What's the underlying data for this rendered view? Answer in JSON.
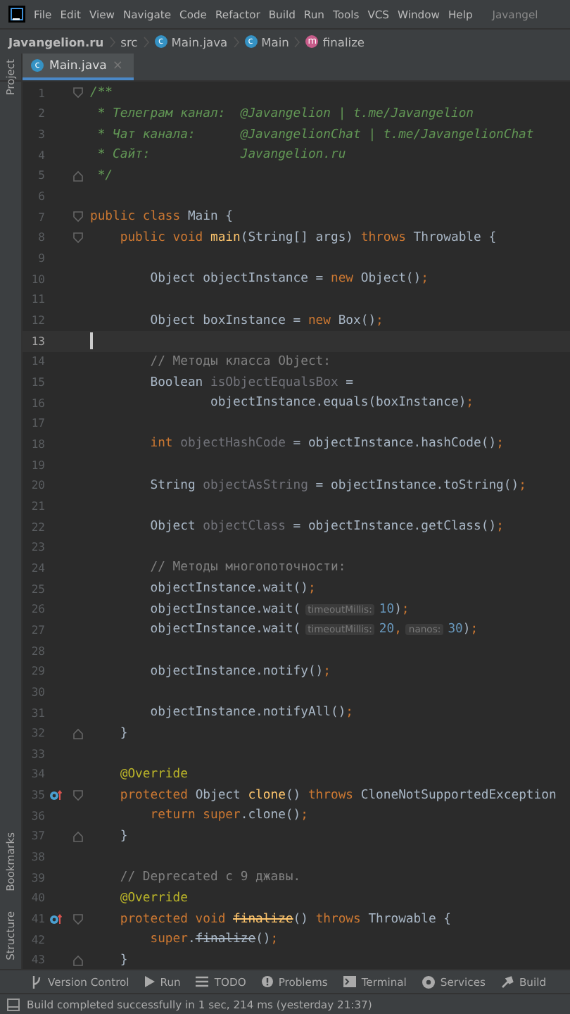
{
  "menu_bar": {
    "items": [
      "File",
      "Edit",
      "View",
      "Navigate",
      "Code",
      "Refactor",
      "Build",
      "Run",
      "Tools",
      "VCS",
      "Window",
      "Help"
    ],
    "project_title": "Javangel"
  },
  "breadcrumbs": [
    {
      "label": "Javangelion.ru",
      "kind": "project"
    },
    {
      "label": "src",
      "kind": "folder"
    },
    {
      "label": "Main.java",
      "kind": "class",
      "badge": "c"
    },
    {
      "label": "Main",
      "kind": "class",
      "badge": "c"
    },
    {
      "label": "finalize",
      "kind": "method",
      "badge": "m"
    }
  ],
  "tabs": [
    {
      "label": "Main.java",
      "badge": "c",
      "selected": true,
      "close": "×"
    }
  ],
  "side_tools": [
    {
      "label": "Project",
      "kind": "top"
    },
    {
      "label": "Bookmarks",
      "kind": "bottom"
    },
    {
      "label": "Structure",
      "kind": "bottom"
    }
  ],
  "lines": [
    {
      "n": "1",
      "current": false,
      "fold": {
        "kind": "start"
      },
      "t": [
        {
          "kind": "doc",
          "text": "/**"
        }
      ]
    },
    {
      "n": "2",
      "current": false,
      "t": [
        {
          "kind": "doc",
          "text": " * Телеграм канал:  @Javangelion | t.me/Javangelion"
        }
      ]
    },
    {
      "n": "3",
      "current": false,
      "t": [
        {
          "kind": "doc",
          "text": " * Чат канала:      @JavangelionChat | t.me/JavangelionChat"
        }
      ]
    },
    {
      "n": "4",
      "current": false,
      "t": [
        {
          "kind": "doc",
          "text": " * Сайт:            Javangelion.ru"
        }
      ]
    },
    {
      "n": "5",
      "current": false,
      "fold": {
        "kind": "end"
      },
      "t": [
        {
          "kind": "doc",
          "text": " */"
        }
      ]
    },
    {
      "n": "6",
      "current": false
    },
    {
      "n": "7",
      "current": false,
      "fold": {
        "kind": "start"
      },
      "t": [
        {
          "kind": "kw",
          "text": "public class "
        },
        {
          "kind": "plain",
          "text": "Main {"
        }
      ]
    },
    {
      "n": "8",
      "current": false,
      "fold": {
        "kind": "start"
      },
      "t": [
        {
          "kind": "kw",
          "text": "    public void "
        },
        {
          "kind": "decl",
          "text": "main"
        },
        {
          "kind": "plain",
          "text": "(String[] args) "
        },
        {
          "kind": "kw",
          "text": "throws "
        },
        {
          "kind": "plain",
          "text": "Throwable {"
        }
      ]
    },
    {
      "n": "9",
      "current": false
    },
    {
      "n": "10",
      "current": false,
      "t": [
        {
          "kind": "plain",
          "text": "        Object objectInstance = "
        },
        {
          "kind": "kw",
          "text": "new "
        },
        {
          "kind": "plain",
          "text": "Object()"
        },
        {
          "kind": "kw",
          "text": ";"
        }
      ]
    },
    {
      "n": "11",
      "current": false
    },
    {
      "n": "12",
      "current": false,
      "t": [
        {
          "kind": "plain",
          "text": "        Object boxInstance = "
        },
        {
          "kind": "kw",
          "text": "new "
        },
        {
          "kind": "plain",
          "text": "Box()"
        },
        {
          "kind": "kw",
          "text": ";"
        }
      ]
    },
    {
      "n": "13",
      "current": true
    },
    {
      "n": "14",
      "current": false,
      "t": [
        {
          "kind": "comment",
          "text": "        // Методы класса Object:"
        }
      ]
    },
    {
      "n": "15",
      "current": false,
      "t": [
        {
          "kind": "plain",
          "text": "        Boolean "
        },
        {
          "kind": "unused",
          "text": "isObjectEqualsBox"
        },
        {
          "kind": "plain",
          "text": " ="
        }
      ]
    },
    {
      "n": "16",
      "current": false,
      "t": [
        {
          "kind": "plain",
          "text": "                objectInstance.equals(boxInstance)"
        },
        {
          "kind": "kw",
          "text": ";"
        }
      ]
    },
    {
      "n": "17",
      "current": false
    },
    {
      "n": "18",
      "current": false,
      "t": [
        {
          "kind": "kw",
          "text": "        int "
        },
        {
          "kind": "unused",
          "text": "objectHashCode"
        },
        {
          "kind": "plain",
          "text": " = objectInstance.hashCode()"
        },
        {
          "kind": "kw",
          "text": ";"
        }
      ]
    },
    {
      "n": "19",
      "current": false
    },
    {
      "n": "20",
      "current": false,
      "t": [
        {
          "kind": "plain",
          "text": "        String "
        },
        {
          "kind": "unused",
          "text": "objectAsString"
        },
        {
          "kind": "plain",
          "text": " = objectInstance.toString()"
        },
        {
          "kind": "kw",
          "text": ";"
        }
      ]
    },
    {
      "n": "21",
      "current": false
    },
    {
      "n": "22",
      "current": false,
      "t": [
        {
          "kind": "plain",
          "text": "        Object "
        },
        {
          "kind": "unused",
          "text": "objectClass"
        },
        {
          "kind": "plain",
          "text": " = objectInstance.getClass()"
        },
        {
          "kind": "kw",
          "text": ";"
        }
      ]
    },
    {
      "n": "23",
      "current": false
    },
    {
      "n": "24",
      "current": false,
      "t": [
        {
          "kind": "comment",
          "text": "        // Методы многопоточности:"
        }
      ]
    },
    {
      "n": "25",
      "current": false,
      "t": [
        {
          "kind": "plain",
          "text": "        objectInstance.wait()"
        },
        {
          "kind": "kw",
          "text": ";"
        }
      ]
    },
    {
      "n": "26",
      "current": false,
      "t": [
        {
          "kind": "plain",
          "text": "        objectInstance.wait("
        },
        {
          "kind": "hint",
          "text": "timeoutMillis:"
        },
        {
          "kind": "num",
          "text": "10"
        },
        {
          "kind": "plain",
          "text": ")"
        },
        {
          "kind": "kw",
          "text": ";"
        }
      ]
    },
    {
      "n": "27",
      "current": false,
      "t": [
        {
          "kind": "plain",
          "text": "        objectInstance.wait("
        },
        {
          "kind": "hint",
          "text": "timeoutMillis:"
        },
        {
          "kind": "num",
          "text": "20"
        },
        {
          "kind": "kw",
          "text": ","
        },
        {
          "kind": "hint",
          "text": "nanos:"
        },
        {
          "kind": "num",
          "text": "30"
        },
        {
          "kind": "plain",
          "text": ")"
        },
        {
          "kind": "kw",
          "text": ";"
        }
      ]
    },
    {
      "n": "28",
      "current": false
    },
    {
      "n": "29",
      "current": false,
      "t": [
        {
          "kind": "plain",
          "text": "        objectInstance.notify()"
        },
        {
          "kind": "kw",
          "text": ";"
        }
      ]
    },
    {
      "n": "30",
      "current": false
    },
    {
      "n": "31",
      "current": false,
      "t": [
        {
          "kind": "plain",
          "text": "        objectInstance.notifyAll()"
        },
        {
          "kind": "kw",
          "text": ";"
        }
      ]
    },
    {
      "n": "32",
      "current": false,
      "fold": {
        "kind": "end"
      },
      "t": [
        {
          "kind": "plain",
          "text": "    }"
        }
      ]
    },
    {
      "n": "33",
      "current": false
    },
    {
      "n": "34",
      "current": false,
      "t": [
        {
          "kind": "annotation",
          "text": "    @Override"
        }
      ]
    },
    {
      "n": "35",
      "current": false,
      "fold": {
        "kind": "start"
      },
      "marker": {
        "kind": "override"
      },
      "t": [
        {
          "kind": "kw",
          "text": "    protected "
        },
        {
          "kind": "plain",
          "text": "Object "
        },
        {
          "kind": "decl",
          "text": "clone"
        },
        {
          "kind": "plain",
          "text": "() "
        },
        {
          "kind": "kw",
          "text": "throws "
        },
        {
          "kind": "plain",
          "text": "CloneNotSupportedException"
        }
      ]
    },
    {
      "n": "36",
      "current": false,
      "t": [
        {
          "kind": "kw",
          "text": "        return super"
        },
        {
          "kind": "plain",
          "text": ".clone()"
        },
        {
          "kind": "kw",
          "text": ";"
        }
      ]
    },
    {
      "n": "37",
      "current": false,
      "fold": {
        "kind": "end"
      },
      "t": [
        {
          "kind": "plain",
          "text": "    }"
        }
      ]
    },
    {
      "n": "38",
      "current": false
    },
    {
      "n": "39",
      "current": false,
      "t": [
        {
          "kind": "comment",
          "text": "    // Deprecated с 9 джавы."
        }
      ]
    },
    {
      "n": "40",
      "current": false,
      "t": [
        {
          "kind": "annotation",
          "text": "    @Override"
        }
      ]
    },
    {
      "n": "41",
      "current": false,
      "fold": {
        "kind": "start"
      },
      "marker": {
        "kind": "override"
      },
      "t": [
        {
          "kind": "kw",
          "text": "    protected void "
        },
        {
          "kind": "decl-deprecated",
          "text": "finalize"
        },
        {
          "kind": "plain",
          "text": "() "
        },
        {
          "kind": "kw",
          "text": "throws "
        },
        {
          "kind": "plain",
          "text": "Throwable {"
        }
      ]
    },
    {
      "n": "42",
      "current": false,
      "t": [
        {
          "kind": "kw",
          "text": "        super"
        },
        {
          "kind": "plain",
          "text": "."
        },
        {
          "kind": "deprecated",
          "text": "finalize"
        },
        {
          "kind": "plain",
          "text": "()"
        },
        {
          "kind": "kw",
          "text": ";"
        }
      ]
    },
    {
      "n": "43",
      "current": false,
      "fold": {
        "kind": "end"
      },
      "t": [
        {
          "kind": "plain",
          "text": "    }"
        }
      ]
    }
  ],
  "tool_windows": [
    {
      "label": "Version Control",
      "kind": "vcs"
    },
    {
      "label": "Run",
      "kind": "run"
    },
    {
      "label": "TODO",
      "kind": "todo"
    },
    {
      "label": "Problems",
      "kind": "problems"
    },
    {
      "label": "Terminal",
      "kind": "terminal"
    },
    {
      "label": "Services",
      "kind": "services"
    },
    {
      "label": "Build",
      "kind": "build"
    }
  ],
  "status_bar": "Build completed successfully in 1 sec, 214 ms (yesterday 21:37)"
}
